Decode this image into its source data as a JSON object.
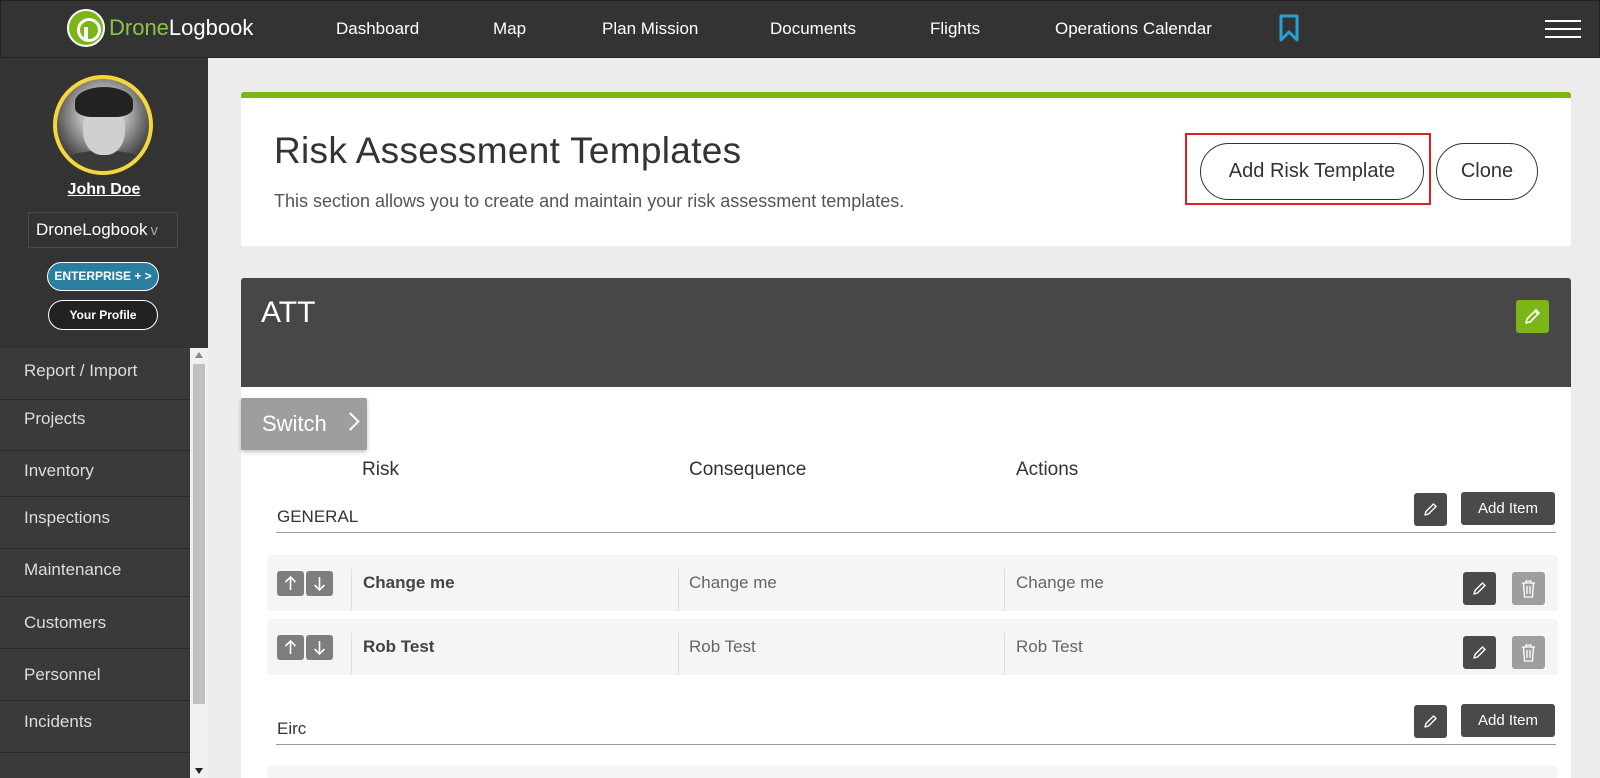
{
  "app": {
    "logo_drone": "Drone",
    "logo_logbook": "Logbook"
  },
  "nav": {
    "items": [
      "Dashboard",
      "Map",
      "Plan Mission",
      "Documents",
      "Flights",
      "Operations Calendar"
    ]
  },
  "sidebar": {
    "user_name": "John Doe",
    "organization": "DroneLogbook",
    "org_caret": "v",
    "enterprise_label": "ENTERPRISE + >",
    "profile_label": "Your Profile",
    "menu": [
      "Report / Import",
      "Projects",
      "Inventory",
      "Inspections",
      "Maintenance",
      "Customers",
      "Personnel",
      "Incidents"
    ]
  },
  "header": {
    "title": "Risk Assessment Templates",
    "description": "This section allows you to create and maintain your risk assessment templates.",
    "add_template_label": "Add Risk Template",
    "clone_label": "Clone"
  },
  "template": {
    "name": "ATT",
    "switch_label": "Switch",
    "columns": [
      "Risk",
      "Consequence",
      "Actions"
    ],
    "sections": [
      {
        "title": "GENERAL",
        "add_item_label": "Add Item",
        "rows": [
          {
            "risk": "Change me",
            "consequence": "Change me",
            "actions": "Change me"
          },
          {
            "risk": "Rob Test",
            "consequence": "Rob Test",
            "actions": "Rob Test"
          }
        ]
      },
      {
        "title": "Eirc",
        "add_item_label": "Add Item",
        "rows": []
      }
    ]
  },
  "colors": {
    "accent_green": "#7cb518",
    "topbar": "#333333",
    "enterprise_blue": "#2a7fa0",
    "bookmark_blue": "#2a9fd6",
    "highlight_red": "#e02020"
  }
}
